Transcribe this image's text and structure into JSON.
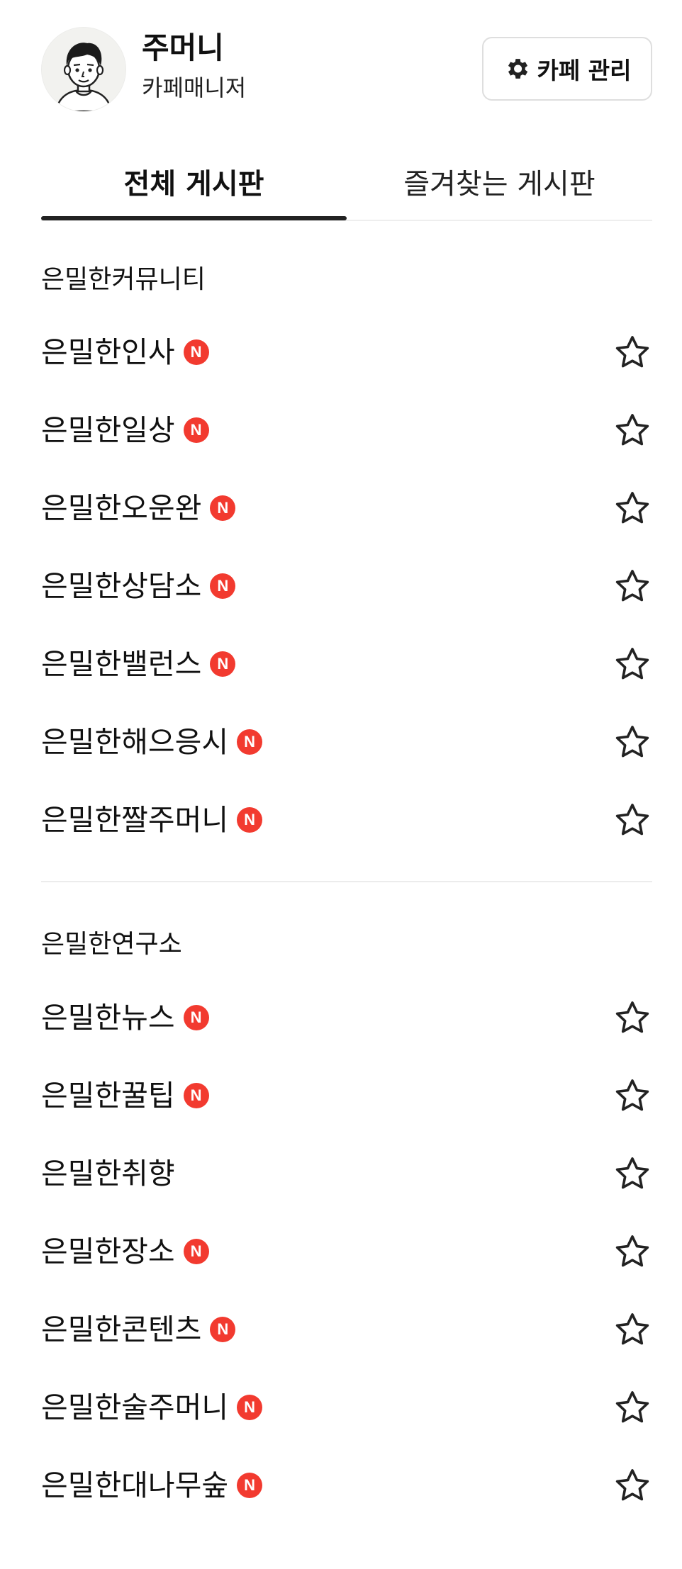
{
  "profile": {
    "name": "주머니",
    "role": "카페매니저",
    "avatar_icon": "user-avatar-icon"
  },
  "manage_button": {
    "label": "카페 관리",
    "icon": "gear-icon"
  },
  "tabs": [
    {
      "label": "전체 게시판",
      "active": true
    },
    {
      "label": "즐겨찾는 게시판",
      "active": false
    }
  ],
  "new_badge_text": "N",
  "colors": {
    "badge": "#f23a2f",
    "active_tab_indicator": "#222222"
  },
  "sections": [
    {
      "title": "은밀한커뮤니티",
      "boards": [
        {
          "label": "은밀한인사",
          "new": true
        },
        {
          "label": "은밀한일상",
          "new": true
        },
        {
          "label": "은밀한오운완",
          "new": true
        },
        {
          "label": "은밀한상담소",
          "new": true
        },
        {
          "label": "은밀한밸런스",
          "new": true
        },
        {
          "label": "은밀한해으응시",
          "new": true
        },
        {
          "label": "은밀한짤주머니",
          "new": true
        }
      ]
    },
    {
      "title": "은밀한연구소",
      "boards": [
        {
          "label": "은밀한뉴스",
          "new": true
        },
        {
          "label": "은밀한꿀팁",
          "new": true
        },
        {
          "label": "은밀한취향",
          "new": false
        },
        {
          "label": "은밀한장소",
          "new": true
        },
        {
          "label": "은밀한콘텐츠",
          "new": true
        },
        {
          "label": "은밀한술주머니",
          "new": true
        },
        {
          "label": "은밀한대나무숲",
          "new": true
        }
      ]
    }
  ]
}
